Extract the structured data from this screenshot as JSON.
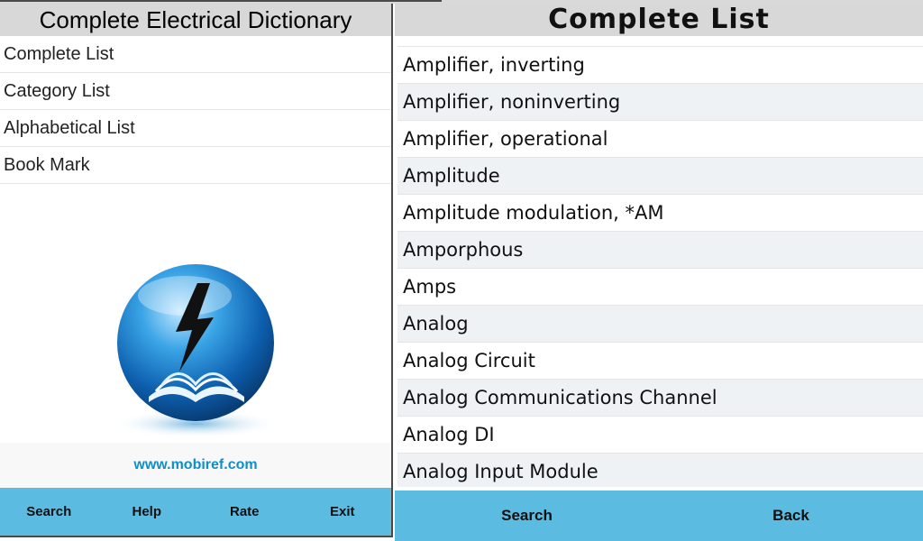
{
  "left": {
    "title": "Complete Electrical Dictionary",
    "menu": [
      {
        "label": "Complete List"
      },
      {
        "label": "Category List"
      },
      {
        "label": "Alphabetical List"
      },
      {
        "label": "Book Mark"
      }
    ],
    "url": "www.mobiref.com",
    "bottom_buttons": [
      "Search",
      "Help",
      "Rate",
      "Exit"
    ]
  },
  "right": {
    "title": "Complete List",
    "items": [
      "Amplifier, inverting",
      "Amplifier, noninverting",
      "Amplifier, operational",
      "Amplitude",
      "Amplitude modulation, *AM",
      "Amporphous",
      "Amps",
      "Analog",
      "Analog Circuit",
      "Analog Communications Channel",
      "Analog DI",
      "Analog Input Module"
    ],
    "bottom_buttons": [
      "Search",
      "Back"
    ]
  },
  "colors": {
    "bar_blue": "#5cbbe0",
    "title_gray": "#d8d8d8",
    "url_blue": "#0f8fc7"
  }
}
